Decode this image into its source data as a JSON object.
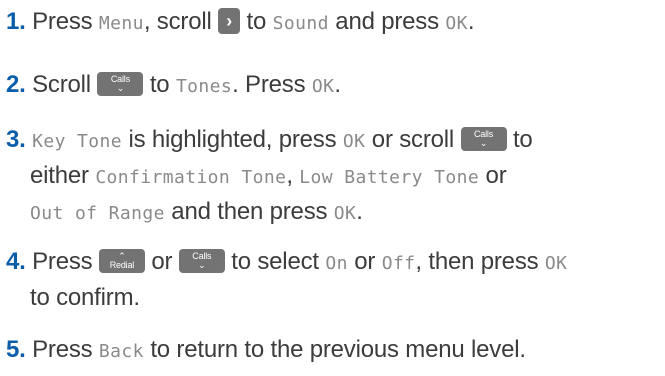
{
  "steps": [
    {
      "number": "1",
      "period": ".",
      "t1": " Press ",
      "menu": "Menu",
      "t2": ", scroll ",
      "arrow_key": "›",
      "t3": " to ",
      "sound": "Sound",
      "t4": " and press ",
      "ok": "OK",
      "t5": "."
    },
    {
      "number": "2",
      "period": ".",
      "t1": " Scroll ",
      "calls_label": "Calls",
      "calls_chevron": "⌄",
      "t2": " to ",
      "tones": "Tones",
      "t3": ". Press ",
      "ok": "OK",
      "t4": "."
    },
    {
      "number": "3",
      "period": ".",
      "key_tone": "Key Tone",
      "t1": " is highlighted, press ",
      "ok": "OK",
      "t2": " or scroll ",
      "calls_label": "Calls",
      "calls_chevron": "⌄",
      "t3": " to",
      "t4": "either ",
      "confirmation_tone": "Confirmation Tone",
      "t5": ", ",
      "low_battery_tone": "Low Battery Tone",
      "t6": " or",
      "out_of_range": "Out of Range",
      "t7": " and then press ",
      "ok2": "OK",
      "t8": "."
    },
    {
      "number": "4",
      "period": ".",
      "t1": " Press ",
      "redial_chevron": "⌃",
      "redial_label": "Redial",
      "t2": " or ",
      "calls_label": "Calls",
      "calls_chevron": "⌄",
      "t3": " to select ",
      "on": "On",
      "t4": " or ",
      "off": "Off",
      "t5": ", then press ",
      "ok": "OK",
      "t6": "to confirm."
    },
    {
      "number": "5",
      "period": ".",
      "t1": " Press ",
      "back": "Back",
      "t2": " to return to the previous menu level."
    }
  ]
}
